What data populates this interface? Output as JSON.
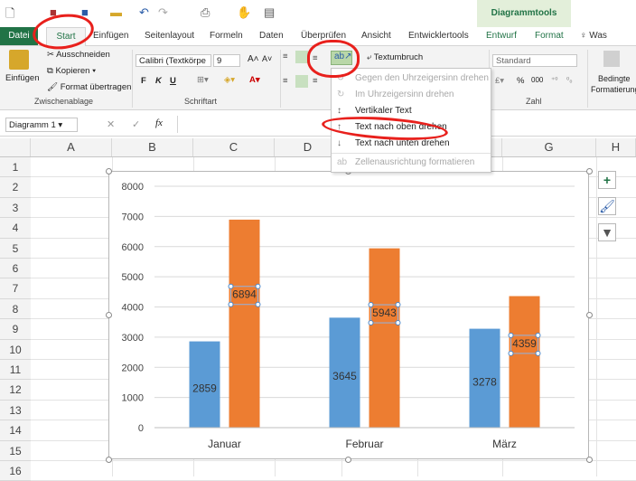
{
  "titlebar": {
    "chart_tools": "Diagrammtools",
    "qat_icons": [
      "new-icon",
      "save-icon",
      "autosave-icon",
      "folder-icon",
      "undo-icon",
      "redo-icon",
      "print-preview-icon",
      "touch-mode-icon",
      "form-icon"
    ]
  },
  "tabs": [
    {
      "label": "Datei"
    },
    {
      "label": "Start"
    },
    {
      "label": "Einfügen"
    },
    {
      "label": "Seitenlayout"
    },
    {
      "label": "Formeln"
    },
    {
      "label": "Daten"
    },
    {
      "label": "Überprüfen"
    },
    {
      "label": "Ansicht"
    },
    {
      "label": "Entwicklertools"
    },
    {
      "label": "Entwurf"
    },
    {
      "label": "Format"
    }
  ],
  "tell_me": "Was möchte",
  "ribbon": {
    "clipboard": {
      "label": "Zwischenablage",
      "paste": "Einfügen",
      "cut": "Ausschneiden",
      "copy": "Kopieren",
      "format_painter": "Format übertragen"
    },
    "font": {
      "label": "Schriftart",
      "name": "Calibri (Textkörpe",
      "size": "9",
      "bold": "F",
      "italic": "K",
      "underline": "U"
    },
    "alignment": {
      "wrap": "Textumbruch"
    },
    "number": {
      "label": "Zahl",
      "format": "Standard",
      "percent": "%",
      "thousands": "000"
    },
    "styles": {
      "label1": "Bedingte",
      "label2": "Formatierung"
    }
  },
  "formula_bar": {
    "name_box": "Diagramm 1",
    "fx": "fx"
  },
  "grid": {
    "columns": [
      "A",
      "B",
      "C",
      "D",
      "E",
      "F",
      "G",
      "H"
    ],
    "rows": [
      "1",
      "2",
      "3",
      "4",
      "5",
      "6",
      "7",
      "8",
      "9",
      "10",
      "11",
      "12",
      "13",
      "14",
      "15",
      "16"
    ]
  },
  "dropdown": {
    "items": [
      {
        "label": "Gegen den Uhrzeigersinn drehen",
        "enabled": false
      },
      {
        "label": "Im Uhrzeigersinn drehen",
        "enabled": false
      },
      {
        "label": "Vertikaler Text",
        "enabled": true
      },
      {
        "label": "Text nach oben drehen",
        "enabled": true
      },
      {
        "label": "Text nach unten drehen",
        "enabled": true
      },
      {
        "label": "Zellenausrichtung formatieren",
        "enabled": false
      }
    ]
  },
  "colors": {
    "excel_green": "#217346",
    "series1": "#5b9bd5",
    "series2": "#ed7d31",
    "annotation": "#e8201c"
  },
  "chart_data": {
    "type": "bar",
    "categories": [
      "Januar",
      "Februar",
      "März"
    ],
    "series": [
      {
        "values": [
          2859,
          3645,
          3278
        ],
        "color": "#5b9bd5"
      },
      {
        "values": [
          6894,
          5943,
          4359
        ],
        "color": "#ed7d31"
      }
    ],
    "ylim": [
      0,
      8000
    ],
    "yticks": [
      "0",
      "1000",
      "2000",
      "3000",
      "4000",
      "5000",
      "6000",
      "7000",
      "8000"
    ],
    "data_labels": [
      "2859",
      "3645",
      "3278",
      "6894",
      "5943",
      "4359"
    ],
    "grid": true
  }
}
